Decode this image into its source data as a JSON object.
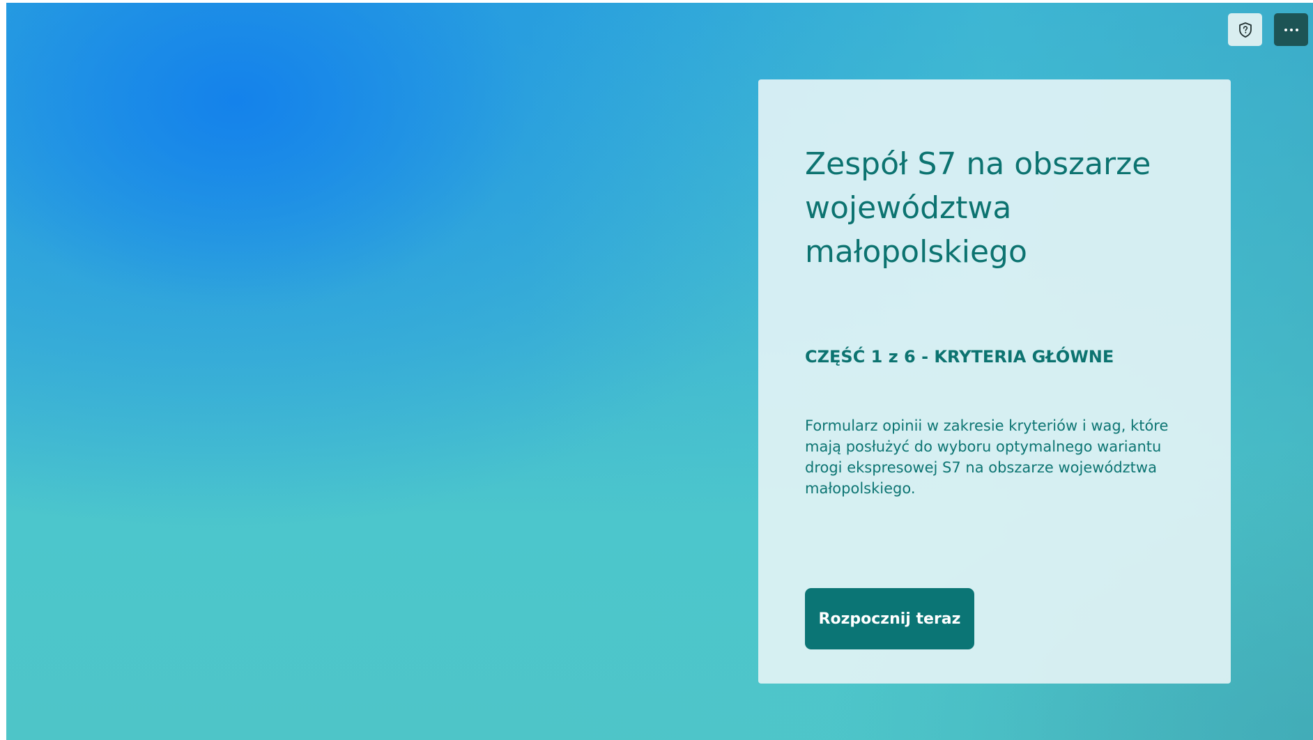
{
  "toolbar": {
    "shield_icon": "shield-question-icon",
    "more_icon": "more-options-icon"
  },
  "card": {
    "title": "Zespół S7 na obszarze województwa małopolskiego",
    "subtitle": "CZĘŚĆ 1 z 6 - KRYTERIA GŁÓWNE",
    "description": "Formularz opinii w zakresie kryteriów i wag, które mają posłużyć do wyboru optymalnego wariantu drogi ekspresowej S7 na obszarze województwa małopolskiego.",
    "start_button_label": "Rozpocznij teraz"
  },
  "colors": {
    "accent": "#0b7575",
    "text": "#0c7370",
    "background_top": "#1a8ae8",
    "background_bottom": "#4ec5c8",
    "card_background": "#e6f4f6",
    "more_button": "#1d5455"
  }
}
